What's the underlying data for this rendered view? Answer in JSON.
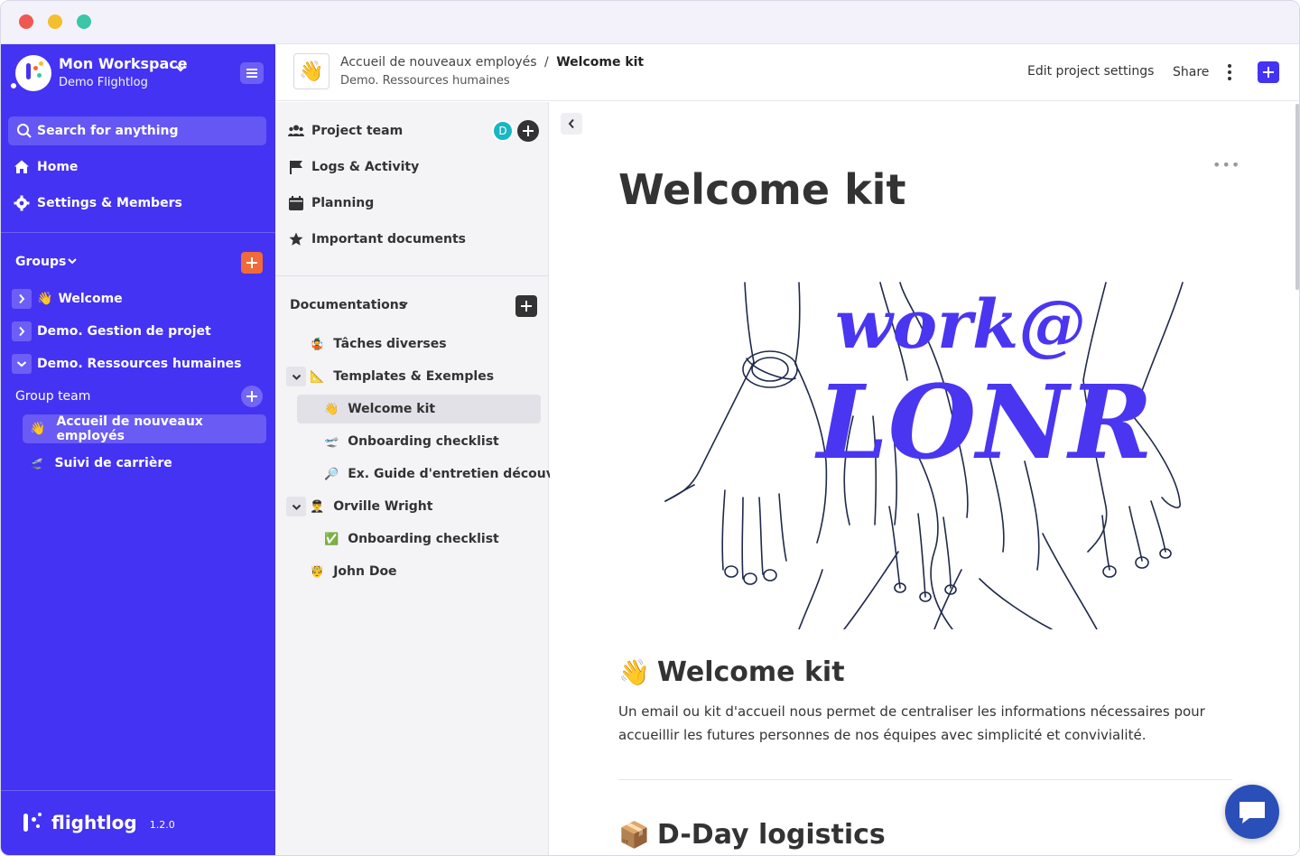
{
  "sidebar": {
    "workspace_name": "Mon Workspace",
    "workspace_sub": "Demo Flightlog",
    "search_placeholder": "Search for anything",
    "nav": [
      {
        "label": "Home",
        "icon": "home-icon"
      },
      {
        "label": "Settings & Members",
        "icon": "gear-icon"
      }
    ],
    "groups_title": "Groups",
    "groups": [
      {
        "label": "Welcome",
        "emoji": "👋",
        "expanded": false
      },
      {
        "label": "Demo. Gestion de projet",
        "expanded": false
      },
      {
        "label": "Demo. Ressources humaines",
        "expanded": true
      }
    ],
    "group_team_label": "Group team",
    "projects": [
      {
        "label": "Accueil de nouveaux employés",
        "emoji": "👋"
      },
      {
        "label": "Suivi de carrière",
        "emoji": "🛫"
      }
    ],
    "brand": "flightlog",
    "version": "1.2.0"
  },
  "header": {
    "project_emoji": "👋",
    "breadcrumb_parent": "Accueil de nouveaux employés",
    "breadcrumb_sep": "/",
    "breadcrumb_current": "Welcome kit",
    "subtitle": "Demo. Ressources humaines",
    "edit_settings": "Edit project settings",
    "share": "Share"
  },
  "project_panel": {
    "items": [
      {
        "label": "Project team",
        "icon": "team-icon"
      },
      {
        "label": "Logs & Activity",
        "icon": "flag-icon"
      },
      {
        "label": "Planning",
        "icon": "calendar-icon"
      },
      {
        "label": "Important documents",
        "icon": "star-icon"
      }
    ],
    "team_avatar_initial": "D",
    "docs_title": "Documentations",
    "docs": [
      {
        "label": "Tâches diverses",
        "emoji": "🤹"
      },
      {
        "label": "Templates & Exemples",
        "emoji": "📐"
      },
      {
        "label": "Welcome kit",
        "emoji": "👋"
      },
      {
        "label": "Onboarding checklist",
        "emoji": "🛫"
      },
      {
        "label": "Ex. Guide d'entretien découve...",
        "emoji": "🔎"
      },
      {
        "label": "Orville Wright",
        "emoji": "👨‍✈️"
      },
      {
        "label": "Onboarding checklist",
        "emoji": "✅"
      },
      {
        "label": "John Doe",
        "emoji": "🤴"
      }
    ]
  },
  "document": {
    "title": "Welcome kit",
    "illustration_text": {
      "line1": "work@",
      "line2": "LONR"
    },
    "section1_emoji": "👋",
    "section1_title": "Welcome kit",
    "section1_body": "Un email ou kit d'accueil nous permet de centraliser les informations nécessaires pour accueillir les futures personnes de nos équipes avec simplicité et convivialité.",
    "section2_emoji": "📦",
    "section2_title": "D-Day logistics"
  },
  "colors": {
    "sidebar_bg": "#4433f2",
    "accent_orange": "#f06a3a",
    "illustration_purple": "#4a36f0",
    "chat_button": "#2b4fb8"
  }
}
